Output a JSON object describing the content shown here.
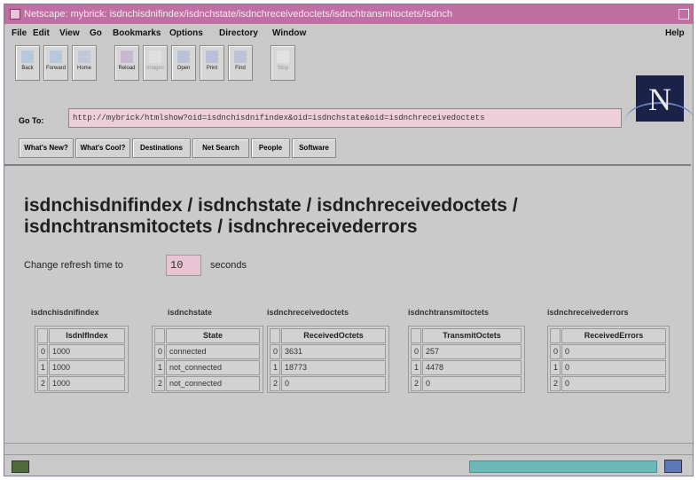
{
  "window": {
    "title": "Netscape: mybrick: isdnchisdnifindex/isdnchstate/isdnchreceivedoctets/isdnchtransmitoctets/isdnch"
  },
  "menu": [
    "File",
    "Edit",
    "View",
    "Go",
    "Bookmarks",
    "Options",
    "Directory",
    "Window",
    "Help"
  ],
  "toolbar": {
    "buttons": [
      {
        "label": "Back",
        "icon": "back-arrow-icon"
      },
      {
        "label": "Forward",
        "icon": "forward-arrow-icon"
      },
      {
        "label": "Home",
        "icon": "home-icon"
      },
      {
        "label": "Reload",
        "icon": "reload-icon"
      },
      {
        "label": "Images",
        "icon": "images-icon"
      },
      {
        "label": "Open",
        "icon": "open-icon"
      },
      {
        "label": "Print",
        "icon": "print-icon"
      },
      {
        "label": "Find",
        "icon": "find-icon"
      },
      {
        "label": "Stop",
        "icon": "stop-icon"
      }
    ]
  },
  "location": {
    "label": "Go To:",
    "url": "http://mybrick/htmlshow?oid=isdnchisdnifindex&oid=isdnchstate&oid=isdnchreceivedoctets"
  },
  "directory_buttons": [
    "What's New?",
    "What's Cool?",
    "Destinations",
    "Net Search",
    "People",
    "Software"
  ],
  "logo": {
    "letter": "N"
  },
  "page": {
    "title": "isdnchisdnifindex / isdnchstate / isdnchreceivedoctets / isdnchtransmitoctets / isdnchreceivederrors",
    "refresh_prefix": "Change refresh time to",
    "refresh_value": "10",
    "refresh_suffix": "seconds"
  },
  "tables": [
    {
      "group": "isdnchisdnifindex",
      "column": "IsdnIfIndex",
      "rows": [
        [
          "0",
          "1000"
        ],
        [
          "1",
          "1000"
        ],
        [
          "2",
          "1000"
        ]
      ]
    },
    {
      "group": "isdnchstate",
      "column": "State",
      "rows": [
        [
          "0",
          "connected"
        ],
        [
          "1",
          "not_connected"
        ],
        [
          "2",
          "not_connected"
        ]
      ]
    },
    {
      "group": "isdnchreceivedoctets",
      "column": "ReceivedOctets",
      "rows": [
        [
          "0",
          "3631"
        ],
        [
          "1",
          "18773"
        ],
        [
          "2",
          "0"
        ]
      ]
    },
    {
      "group": "isdnchtransmitoctets",
      "column": "TransmitOctets",
      "rows": [
        [
          "0",
          "257"
        ],
        [
          "1",
          "4478"
        ],
        [
          "2",
          "0"
        ]
      ]
    },
    {
      "group": "isdnchreceivederrors",
      "column": "ReceivedErrors",
      "rows": [
        [
          "0",
          "0"
        ],
        [
          "1",
          "0"
        ],
        [
          "2",
          "0"
        ]
      ]
    }
  ],
  "colors": {
    "titlebar": "#c06fa3",
    "location_bg": "#eecfd9",
    "progress": "#6ab8b8"
  }
}
